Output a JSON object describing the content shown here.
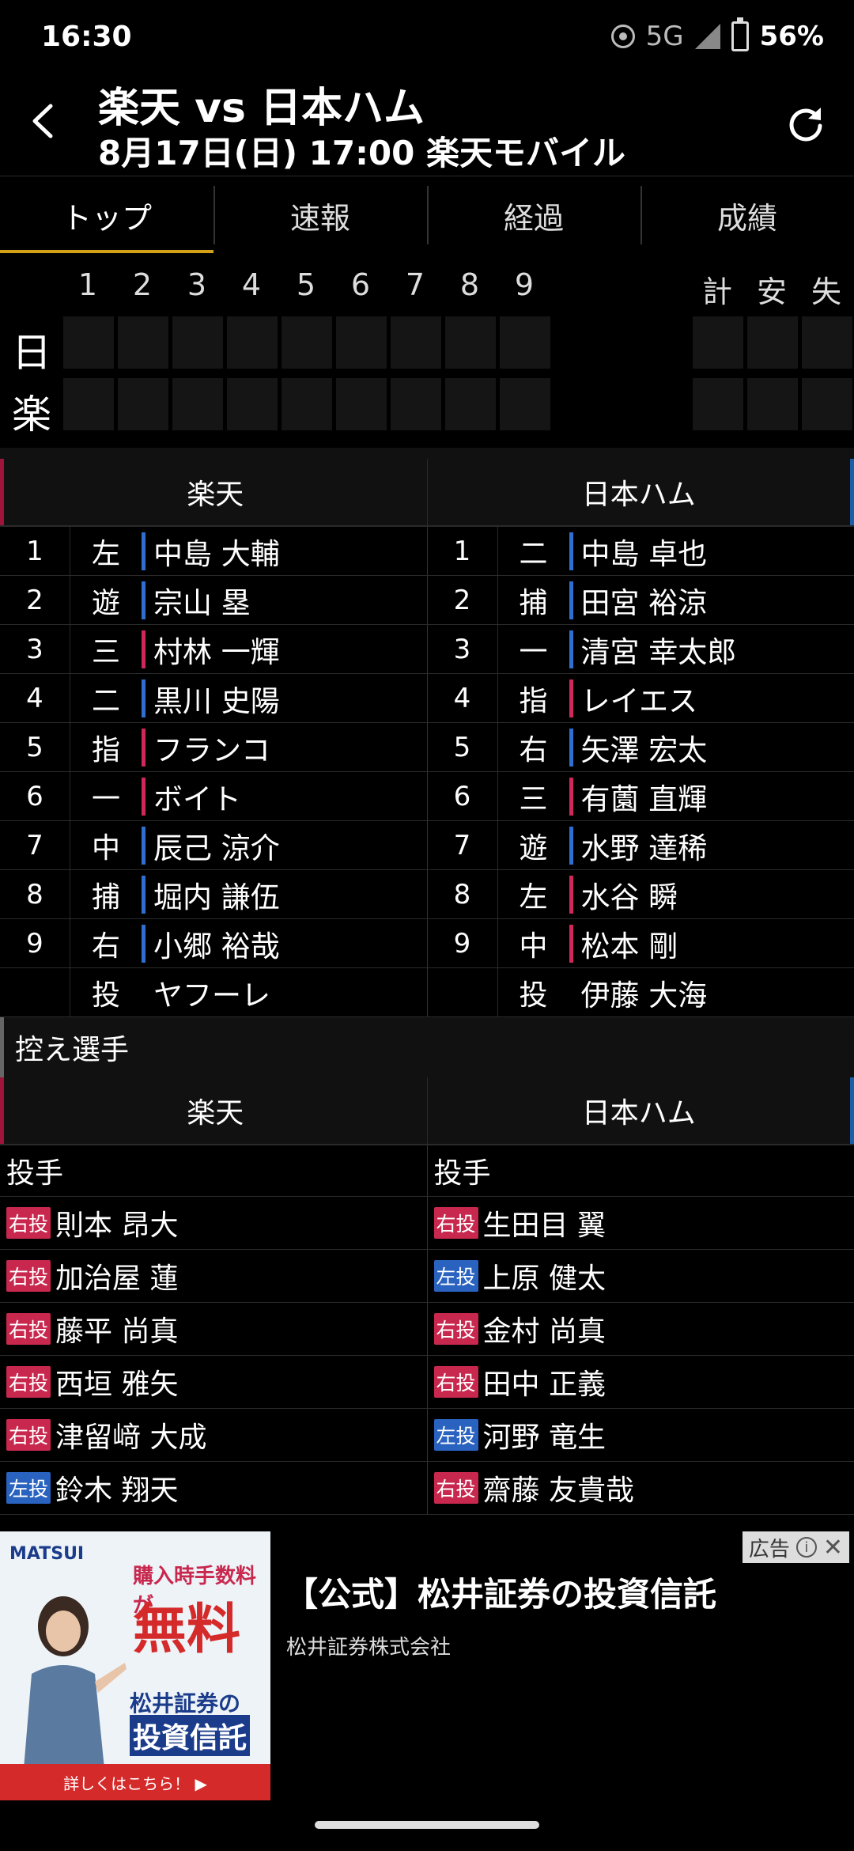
{
  "status": {
    "time": "16:30",
    "network": "5G",
    "battery": "56%"
  },
  "header": {
    "title": "楽天 vs 日本ハム",
    "subtitle": "8月17日(日) 17:00 楽天モバイル"
  },
  "tabs": [
    {
      "label": "トップ"
    },
    {
      "label": "速報"
    },
    {
      "label": "経過"
    },
    {
      "label": "成績"
    }
  ],
  "scoreboard": {
    "innings": [
      "1",
      "2",
      "3",
      "4",
      "5",
      "6",
      "7",
      "8",
      "9"
    ],
    "totals": [
      "計",
      "安",
      "失"
    ],
    "teams": [
      "日",
      "楽"
    ]
  },
  "lineup": {
    "left_team": "楽天",
    "right_team": "日本ハム",
    "rows": [
      {
        "l_order": "1",
        "l_pos": "左",
        "l_name": "中島 大輔",
        "r_order": "1",
        "r_pos": "二",
        "r_name": "中島 卓也"
      },
      {
        "l_order": "2",
        "l_pos": "遊",
        "l_name": "宗山 塁",
        "r_order": "2",
        "r_pos": "捕",
        "r_name": "田宮 裕涼"
      },
      {
        "l_order": "3",
        "l_pos": "三",
        "l_name": "村林 一輝",
        "r_order": "3",
        "r_pos": "一",
        "r_name": "清宮 幸太郎"
      },
      {
        "l_order": "4",
        "l_pos": "二",
        "l_name": "黒川 史陽",
        "r_order": "4",
        "r_pos": "指",
        "r_name": "レイエス"
      },
      {
        "l_order": "5",
        "l_pos": "指",
        "l_name": "フランコ",
        "r_order": "5",
        "r_pos": "右",
        "r_name": "矢澤 宏太"
      },
      {
        "l_order": "6",
        "l_pos": "一",
        "l_name": "ボイト",
        "r_order": "6",
        "r_pos": "三",
        "r_name": "有薗 直輝"
      },
      {
        "l_order": "7",
        "l_pos": "中",
        "l_name": "辰己 涼介",
        "r_order": "7",
        "r_pos": "遊",
        "r_name": "水野 達稀"
      },
      {
        "l_order": "8",
        "l_pos": "捕",
        "l_name": "堀内 謙伍",
        "r_order": "8",
        "r_pos": "左",
        "r_name": "水谷 瞬"
      },
      {
        "l_order": "9",
        "l_pos": "右",
        "l_name": "小郷 裕哉",
        "r_order": "9",
        "r_pos": "中",
        "r_name": "松本 剛"
      },
      {
        "l_order": "",
        "l_pos": "投",
        "l_name": "ヤフーレ",
        "r_order": "",
        "r_pos": "投",
        "r_name": "伊藤 大海"
      }
    ]
  },
  "bench": {
    "title": "控え選手",
    "left_team": "楽天",
    "right_team": "日本ハム",
    "section": "投手",
    "rows": [
      {
        "l_badge": "右投",
        "l_name": "則本 昂大",
        "r_badge": "右投",
        "r_name": "生田目 翼"
      },
      {
        "l_badge": "右投",
        "l_name": "加治屋 蓮",
        "r_badge": "左投",
        "r_name": "上原 健太"
      },
      {
        "l_badge": "右投",
        "l_name": "藤平 尚真",
        "r_badge": "右投",
        "r_name": "金村 尚真"
      },
      {
        "l_badge": "右投",
        "l_name": "西垣 雅矢",
        "r_badge": "右投",
        "r_name": "田中 正義"
      },
      {
        "l_badge": "右投",
        "l_name": "津留﨑 大成",
        "r_badge": "左投",
        "r_name": "河野 竜生"
      },
      {
        "l_badge": "左投",
        "l_name": "鈴木 翔天",
        "r_badge": "右投",
        "r_name": "齋藤 友貴哉"
      }
    ]
  },
  "ad": {
    "tag": "広告",
    "brand": "MATSUI",
    "image_line1": "購入時手数料が",
    "image_big": "無料",
    "image_line3": "松井証券の",
    "image_line4": "投資信託",
    "image_cta": "詳しくはこちら！ ▶",
    "title": "【公式】松井証券の投資信託",
    "advertiser": "松井証券株式会社"
  }
}
